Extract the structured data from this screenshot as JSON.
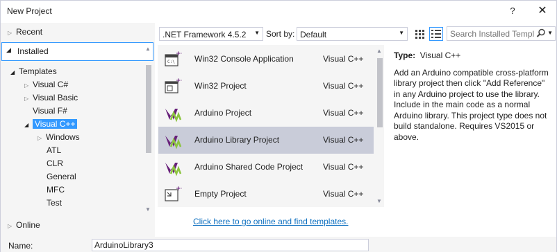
{
  "window": {
    "title": "New Project",
    "help_glyph": "?",
    "close_glyph": "✕"
  },
  "tree": {
    "recent": "Recent",
    "installed": "Installed",
    "templates": "Templates",
    "visual_csharp": "Visual C#",
    "visual_basic": "Visual Basic",
    "visual_fsharp": "Visual F#",
    "visual_cpp": "Visual C++",
    "windows": "Windows",
    "atl": "ATL",
    "clr": "CLR",
    "general": "General",
    "mfc": "MFC",
    "test": "Test",
    "online": "Online"
  },
  "toolbar": {
    "framework": ".NET Framework 4.5.2",
    "sort_label": "Sort by:",
    "sort_value": "Default",
    "search_placeholder": "Search Installed Templ"
  },
  "templates": [
    {
      "name": "Win32 Console Application",
      "lang": "Visual C++",
      "icon": "console-app-icon"
    },
    {
      "name": "Win32 Project",
      "lang": "Visual C++",
      "icon": "win32-project-icon"
    },
    {
      "name": "Arduino Project",
      "lang": "Visual C++",
      "icon": "arduino-icon"
    },
    {
      "name": "Arduino Library Project",
      "lang": "Visual C++",
      "icon": "arduino-icon",
      "selected": true
    },
    {
      "name": "Arduino Shared Code Project",
      "lang": "Visual C++",
      "icon": "arduino-icon"
    },
    {
      "name": "Empty Project",
      "lang": "Visual C++",
      "icon": "empty-project-icon"
    }
  ],
  "online_link": "Click here to go online and find templates.",
  "details": {
    "type_label": "Type:",
    "type_value": "Visual C++",
    "description": "Add an Arduino compatible cross-platform library project then click \"Add Reference\" in any Arduino project to use the library. Include in the main code as a normal Arduino library. This project type does not build standalone. Requires VS2015 or above."
  },
  "form": {
    "name_label": "Name:",
    "name_value": "ArduinoLibrary3"
  },
  "colors": {
    "accent": "#3399ff",
    "selected_row": "#c9ccd9",
    "link": "#0e70c0",
    "arduino_purple": "#68217a",
    "arduino_green": "#8cc43f"
  }
}
